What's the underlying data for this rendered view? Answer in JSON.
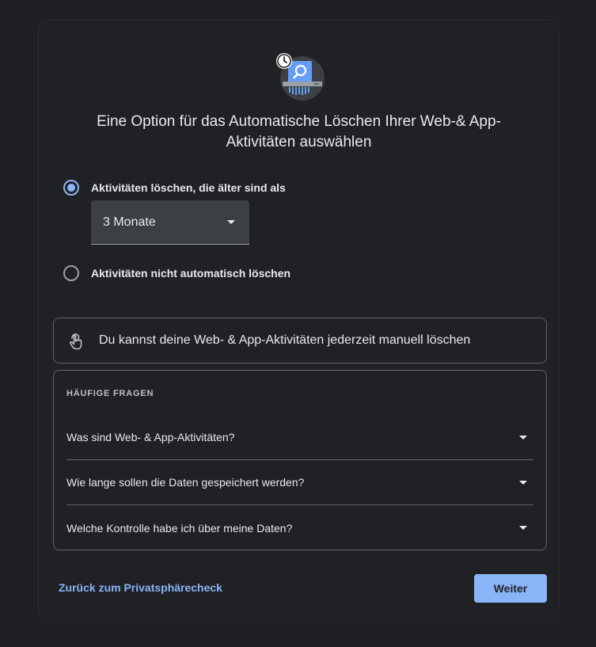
{
  "headline": "Eine Option für das Automatische Löschen Ihrer Web-& App-Aktivitäten auswählen",
  "options": [
    {
      "label": "Aktivitäten löschen, die älter sind als",
      "selected": true
    },
    {
      "label": "Aktivitäten nicht automatisch löschen",
      "selected": false
    }
  ],
  "select": {
    "value": "3 Monate"
  },
  "info": {
    "text": "Du kannst deine Web- & App-Aktivitäten jederzeit manuell löschen",
    "icon": "touch-hand-icon"
  },
  "faq": {
    "title": "HÄUFIGE FRAGEN",
    "items": [
      {
        "question": "Was sind Web- & App-Aktivitäten?"
      },
      {
        "question": "Wie lange sollen die Daten gespeichert werden?"
      },
      {
        "question": "Welche Kontrolle habe ich über meine Daten?"
      }
    ]
  },
  "footer": {
    "back_label": "Zurück zum Privatsphärecheck",
    "next_label": "Weiter"
  },
  "colors": {
    "accent": "#8ab4f8",
    "background": "#202124"
  }
}
